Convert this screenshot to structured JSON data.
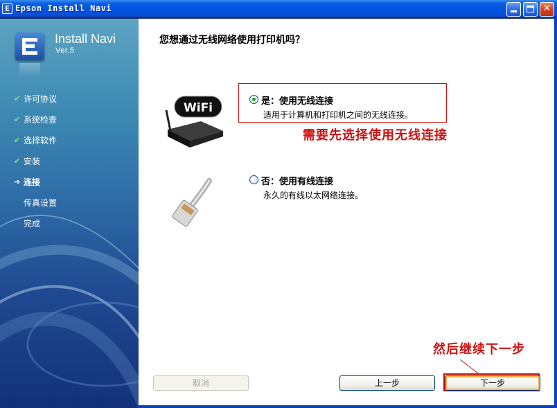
{
  "window": {
    "title": "Epson Install Navi",
    "app_icon_letter": "E"
  },
  "sidebar": {
    "product_name": "Install Navi",
    "version": "Ver.5",
    "steps": [
      {
        "label": "许可协议",
        "status": "done"
      },
      {
        "label": "系统检查",
        "status": "done"
      },
      {
        "label": "选择软件",
        "status": "done"
      },
      {
        "label": "安装",
        "status": "done"
      },
      {
        "label": "连接",
        "status": "current"
      },
      {
        "label": "传真设置",
        "status": "pending"
      },
      {
        "label": "完成",
        "status": "pending"
      }
    ]
  },
  "main": {
    "question": "您想通过无线网络使用打印机吗？",
    "options": [
      {
        "label": "是：使用无线连接",
        "description": "适用于计算机和打印机之间的无线连接。",
        "selected": true
      },
      {
        "label": "否：使用有线连接",
        "description": "永久的有线以太网络连接。",
        "selected": false
      }
    ],
    "wifi_logo_text": "WiFi"
  },
  "annotations": {
    "select_wireless": "需要先选择使用无线连接",
    "then_next": "然后继续下一步",
    "color": "#d01010"
  },
  "buttons": {
    "cancel": "取消",
    "back": "上一步",
    "next": "下一步"
  },
  "colors": {
    "titlebar": "#0054e3",
    "sidebar_top": "#5da4c3",
    "sidebar_bottom": "#13317a",
    "check": "#9fe07a"
  }
}
